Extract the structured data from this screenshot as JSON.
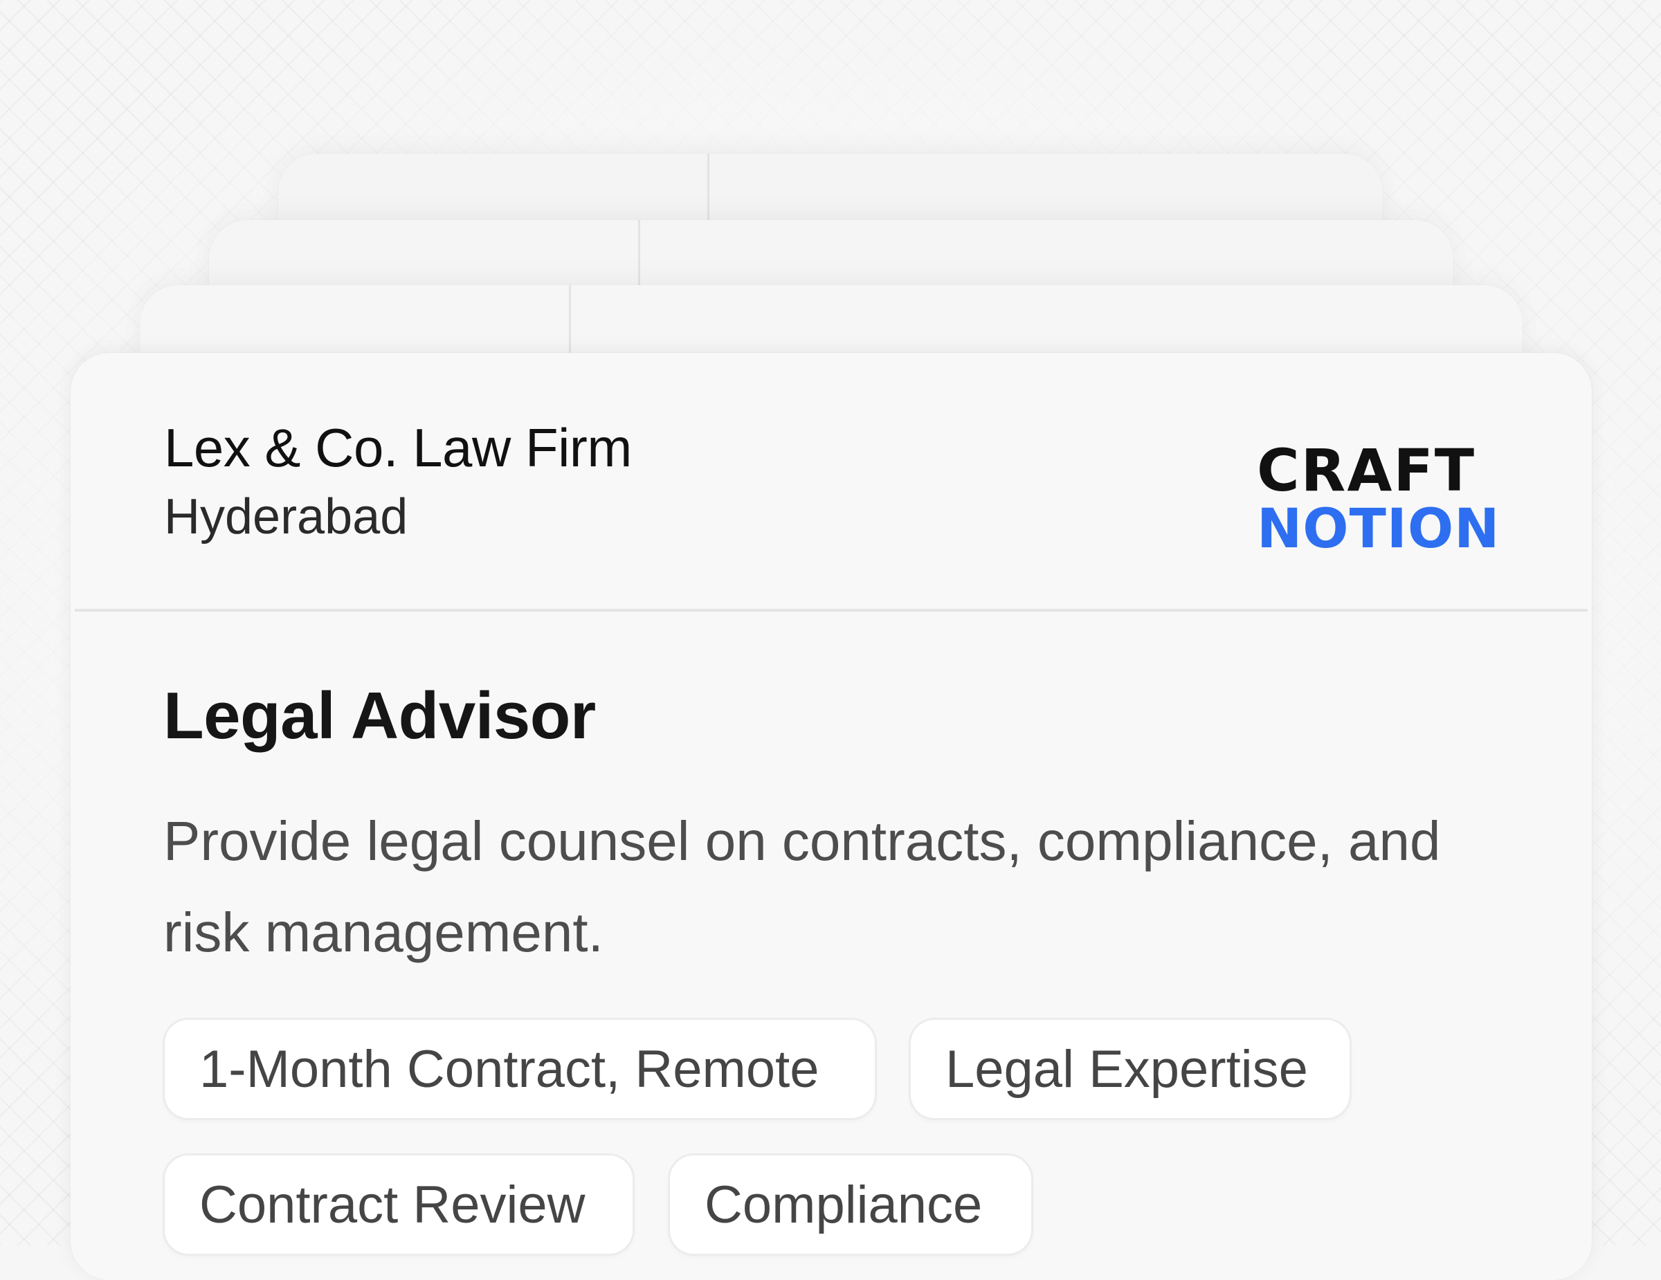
{
  "company": {
    "name": "Lex & Co. Law Firm",
    "location": "Hyderabad"
  },
  "logo": {
    "line1": "CRAFT",
    "line2": "NOTION",
    "color_primary": "#111111",
    "color_accent": "#2d6ff0"
  },
  "job": {
    "title": "Legal Advisor",
    "description": "Provide legal counsel on contracts, compliance, and risk management.",
    "tags": [
      "1-Month Contract, Remote",
      "Legal Expertise",
      "Contract Review",
      "Compliance"
    ]
  },
  "colors": {
    "background": "#f6f6f6",
    "card": "#f8f8f8",
    "tag_bg": "#ffffff",
    "text_primary": "#111111",
    "text_secondary": "#4d4d4d"
  }
}
